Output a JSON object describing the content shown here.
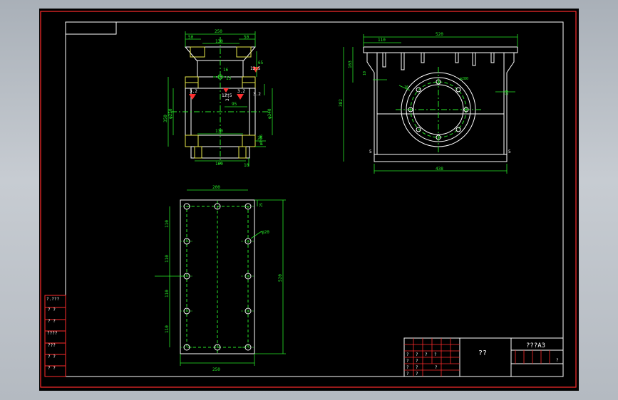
{
  "colors": {
    "frame": "#ff2b2b",
    "outline": "#ffffff",
    "dims": "#27e827",
    "hidden": "#e8e84a",
    "center": "#27e827",
    "marker": "#ff3030"
  },
  "sheet": {
    "title_block": {
      "name": "??",
      "format": "???A3",
      "grid_marks": [
        "?",
        "?",
        "?",
        "?",
        "?",
        "?",
        "?",
        "?",
        "?",
        "?",
        "?",
        "?"
      ]
    }
  },
  "left_table": [
    "?.???",
    "? ?",
    "? ?",
    "????",
    "???",
    "? ?",
    "? ?"
  ],
  "front_view": {
    "dims": {
      "top_width": "250",
      "left_flange": "50",
      "right_flange": "50",
      "inner_top": "130",
      "pipe_dia": "16",
      "r_side": "65",
      "weld1": "12.5",
      "weld2": "12.5",
      "weld3": "3.2",
      "weld4": "3.2",
      "weld5": "3.2",
      "height_left": "350",
      "dia_left": "φ250",
      "dia_right": "φ340",
      "dim_95": "95",
      "bot_inner": "130",
      "bot_width": "160",
      "dim_right_a": "25",
      "dim_right_b": "φ8~M6",
      "dim_small": "10",
      "dim_c": "15",
      "dim_d": "3.2"
    }
  },
  "side_view": {
    "dims": {
      "top_width": "520",
      "top_left": "110",
      "height_left": "382",
      "h2": "163",
      "flange_r": "10",
      "small_r": "16",
      "bottom_width": "438",
      "dim_rt": "10",
      "corner": "5",
      "corner2": "5",
      "circle_label": "φ280"
    }
  },
  "plate_view": {
    "dims": {
      "top_width": "200",
      "bottom_width": "250",
      "height": "520",
      "hole_label": "φ20",
      "corner_label": "25",
      "seg1": "110",
      "seg2": "110",
      "seg3": "110",
      "seg4": "110"
    }
  }
}
